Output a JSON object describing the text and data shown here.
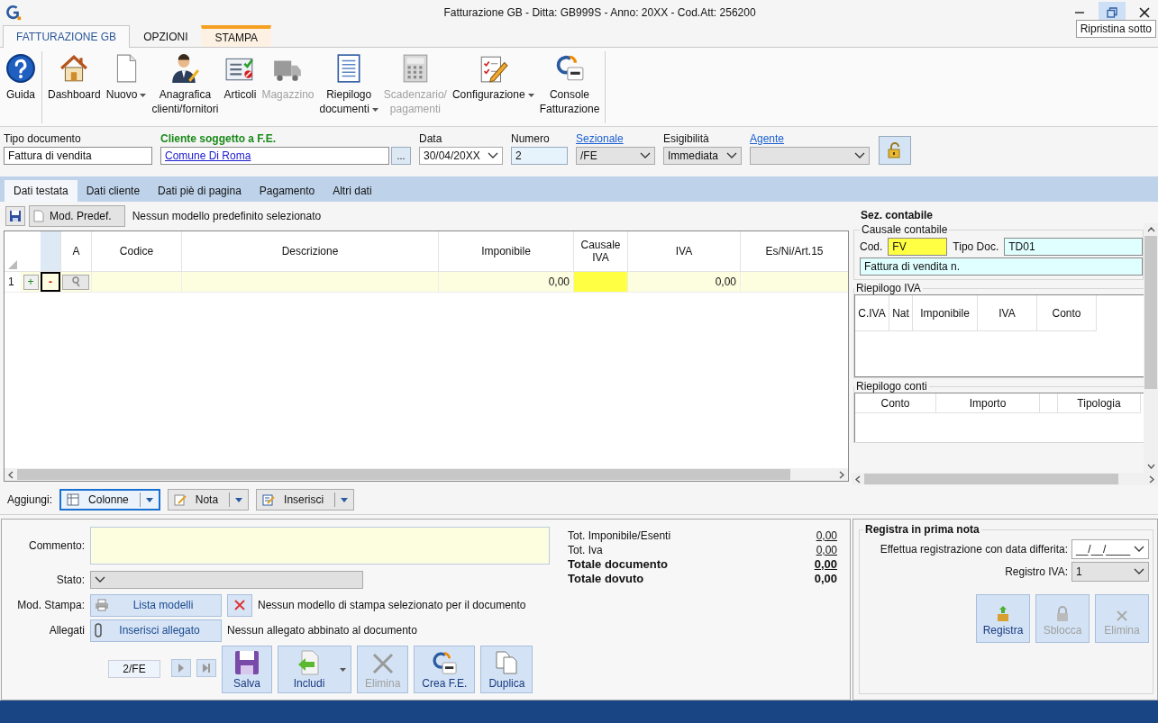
{
  "window": {
    "title": "Fatturazione GB - Ditta: GB999S - Anno: 20XX - Cod.Att: 256200",
    "tooltip": "Ripristina sotto"
  },
  "ribbon_tabs": [
    {
      "label": "FATTURAZIONE GB",
      "selected": true,
      "contextual": false
    },
    {
      "label": "OPZIONI",
      "selected": false,
      "contextual": false
    },
    {
      "label": "STAMPA",
      "selected": false,
      "contextual": true
    }
  ],
  "ribbon_groups": [
    {
      "buttons": [
        {
          "label": "Guida",
          "disabled": false,
          "dropdown": false
        }
      ]
    },
    {
      "buttons": [
        {
          "label": "Dashboard",
          "disabled": false,
          "dropdown": false
        },
        {
          "label": "Nuovo",
          "disabled": false,
          "dropdown": true
        },
        {
          "label": "Anagrafica\nclienti/fornitori",
          "disabled": false,
          "dropdown": false
        },
        {
          "label": "Articoli",
          "disabled": false,
          "dropdown": false
        },
        {
          "label": "Magazzino",
          "disabled": true,
          "dropdown": false
        },
        {
          "label": "Riepilogo\ndocumenti",
          "disabled": false,
          "dropdown": true
        },
        {
          "label": "Scadenzario/\npagamenti",
          "disabled": true,
          "dropdown": false
        },
        {
          "label": "Configurazione",
          "disabled": false,
          "dropdown": true
        },
        {
          "label": "Console\nFatturazione",
          "disabled": false,
          "dropdown": false
        }
      ]
    }
  ],
  "header_fields": [
    {
      "label": "Tipo documento",
      "kind": "text",
      "value": "Fattura di vendita"
    },
    {
      "label": "Cliente soggetto a F.E.",
      "kind": "client",
      "value": "Comune Di Roma",
      "button": "..."
    },
    {
      "label": "Data",
      "kind": "date",
      "value": "30/04/20XX"
    },
    {
      "label": "Numero",
      "kind": "number",
      "value": "2"
    },
    {
      "label": "Sezionale",
      "kind": "select",
      "link": true,
      "value": "/FE"
    },
    {
      "label": "Esigibilità",
      "kind": "select",
      "link": false,
      "value": "Immediata"
    },
    {
      "label": "Agente",
      "kind": "select",
      "link": true
    }
  ],
  "doc_tabs": [
    {
      "label": "Dati testata",
      "selected": true
    },
    {
      "label": "Dati cliente",
      "selected": false
    },
    {
      "label": "Dati piè di pagina",
      "selected": false
    },
    {
      "label": "Pagamento",
      "selected": false
    },
    {
      "label": "Altri dati",
      "selected": false
    }
  ],
  "grid_toolbar": {
    "button": "Mod. Predef.",
    "message": "Nessun modello predefinito selezionato"
  },
  "grid": {
    "columns": [
      "A",
      "Codice",
      "Descrizione",
      "Imponibile",
      "Causale IVA",
      "IVA",
      "Es/Ni/Art.15"
    ],
    "rows": [
      {
        "number": "1",
        "add": "+",
        "remove": "-",
        "imponibile": "0,00",
        "iva": "0,00"
      }
    ]
  },
  "accounting": {
    "title": "Sez. contabile",
    "causale_title": "Causale contabile",
    "cod_label": "Cod.",
    "cod": "FV",
    "tipo_label": "Tipo Doc.",
    "tipo": "TD01",
    "description": "Fattura di vendita n.",
    "iva_title": "Riepilogo IVA",
    "iva_columns": [
      "C.IVA",
      "Nat",
      "Imponibile",
      "IVA",
      "Conto"
    ],
    "conti_title": "Riepilogo conti",
    "conti_columns": [
      "Conto",
      "Importo",
      "Tipologia"
    ]
  },
  "add_bar": {
    "label": "Aggiungi:",
    "buttons": [
      {
        "label": "Colonne",
        "focused": true
      },
      {
        "label": "Nota",
        "focused": false
      },
      {
        "label": "Inserisci",
        "focused": false
      }
    ]
  },
  "footer": {
    "comment_label": "Commento:",
    "state_label": "Stato:",
    "print_label": "Mod. Stampa:",
    "print_button": "Lista modelli",
    "print_message": "Nessun modello di stampa selezionato per il documento",
    "attach_label": "Allegati",
    "attach_button": "Inserisci allegato",
    "attach_message": "Nessun allegato abbinato al documento",
    "nav_value": "2/FE",
    "actions": [
      {
        "label": "Salva",
        "disabled": false,
        "split": false
      },
      {
        "label": "Includi",
        "disabled": false,
        "split": true
      },
      {
        "label": "Elimina",
        "disabled": true,
        "split": false
      },
      {
        "label": "Crea F.E.",
        "disabled": false,
        "split": false
      },
      {
        "label": "Duplica",
        "disabled": false,
        "split": false
      }
    ]
  },
  "totals": [
    {
      "label": "Tot. Imponibile/Esenti",
      "value": "0,00",
      "bold": false,
      "underline": true
    },
    {
      "label": "Tot. Iva",
      "value": "0,00",
      "bold": false,
      "underline": true
    },
    {
      "label": "Totale documento",
      "value": "0,00",
      "bold": true,
      "underline": true
    },
    {
      "label": "Totale dovuto",
      "value": "0,00",
      "bold": true,
      "underline": false
    }
  ],
  "registration": {
    "title": "Registra in prima nota",
    "date_label": "Effettua registrazione con data differita:",
    "date_value": "__/__/____",
    "register_label": "Registro IVA:",
    "register_value": "1",
    "buttons": [
      {
        "label": "Registra",
        "disabled": false
      },
      {
        "label": "Sblocca",
        "disabled": true
      },
      {
        "label": "Elimina",
        "disabled": true
      }
    ]
  }
}
